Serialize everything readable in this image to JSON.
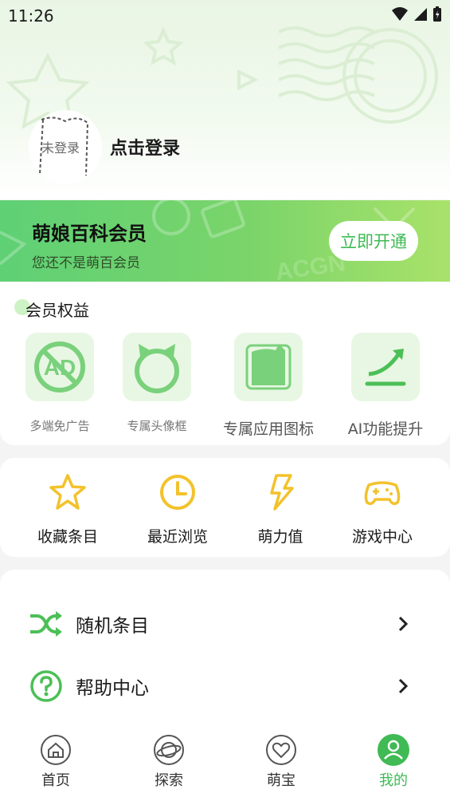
{
  "status_bar": {
    "time": "11:26"
  },
  "profile": {
    "avatar_text": "未登录",
    "login_text": "点击登录"
  },
  "membership": {
    "title": "萌娘百科会员",
    "subtitle": "您还不是萌百会员",
    "button_label": "立即开通",
    "banner_watermark": "ACGN"
  },
  "benefits": {
    "title": "会员权益",
    "items": [
      {
        "label": "多端免广告",
        "icon": "no-ads-icon"
      },
      {
        "label": "专属头像框",
        "icon": "avatar-frame-icon"
      },
      {
        "label": "专属应用图标",
        "icon": "app-icon-icon"
      },
      {
        "label": "AI功能提升",
        "icon": "ai-boost-icon"
      }
    ]
  },
  "quick_actions": [
    {
      "label": "收藏条目",
      "icon": "star-icon"
    },
    {
      "label": "最近浏览",
      "icon": "clock-icon"
    },
    {
      "label": "萌力值",
      "icon": "lightning-icon"
    },
    {
      "label": "游戏中心",
      "icon": "gamepad-icon"
    }
  ],
  "menu": [
    {
      "label": "随机条目",
      "icon": "shuffle-icon"
    },
    {
      "label": "帮助中心",
      "icon": "help-icon"
    }
  ],
  "bottom_nav": [
    {
      "label": "首页",
      "icon": "home-icon",
      "active": false
    },
    {
      "label": "探索",
      "icon": "planet-icon",
      "active": false
    },
    {
      "label": "萌宝",
      "icon": "heart-icon",
      "active": false
    },
    {
      "label": "我的",
      "icon": "user-icon",
      "active": true
    }
  ],
  "colors": {
    "accent": "#3fba54",
    "gold": "#f3c22b",
    "benefit_bg": "#e8f7e3"
  }
}
